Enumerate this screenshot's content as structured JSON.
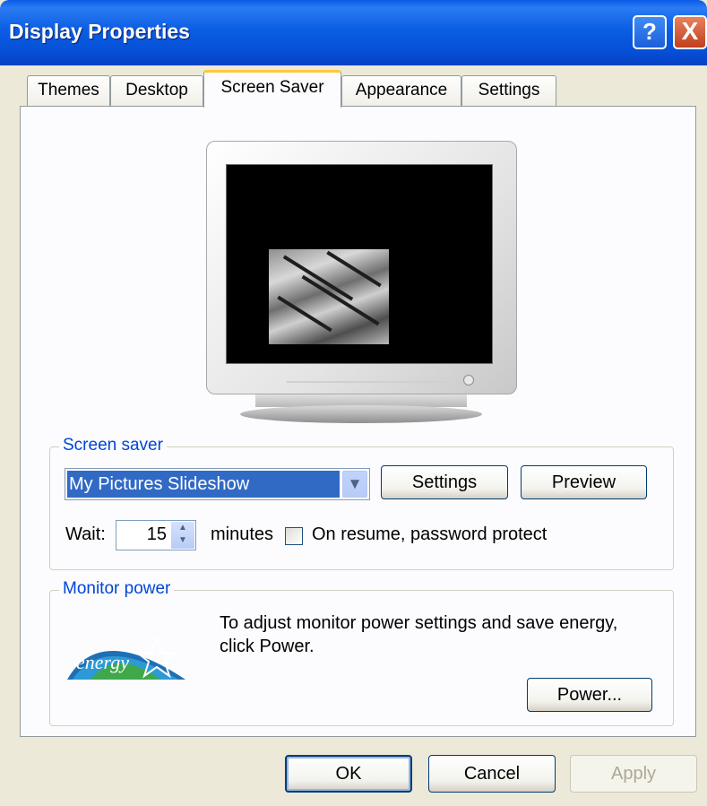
{
  "window": {
    "title": "Display Properties",
    "help_button": "?",
    "close_button": "X",
    "title_bar_color": "#0A5BE8"
  },
  "tabs": [
    {
      "label": "Themes",
      "active": false
    },
    {
      "label": "Desktop",
      "active": false
    },
    {
      "label": "Screen Saver",
      "active": true
    },
    {
      "label": "Appearance",
      "active": false
    },
    {
      "label": "Settings",
      "active": false
    }
  ],
  "screen_saver": {
    "group_label": "Screen saver",
    "selected": "My Pictures Slideshow",
    "settings_button": "Settings",
    "preview_button": "Preview",
    "wait_label": "Wait:",
    "wait_value": "15",
    "minutes_label": "minutes",
    "password_protect_label": "On resume, password protect",
    "password_protect_checked": false
  },
  "monitor_power": {
    "group_label": "Monitor power",
    "description_line1": "To adjust monitor power settings and save energy,",
    "description_line2": "click Power.",
    "power_button": "Power...",
    "logo_text": "energy"
  },
  "footer": {
    "ok_button": "OK",
    "cancel_button": "Cancel",
    "apply_button": "Apply",
    "apply_enabled": false
  },
  "icons": {
    "dropdown": "chevron-down-icon",
    "spin": "spin-up-down-icon",
    "energy_logo": "energy-star-logo"
  }
}
